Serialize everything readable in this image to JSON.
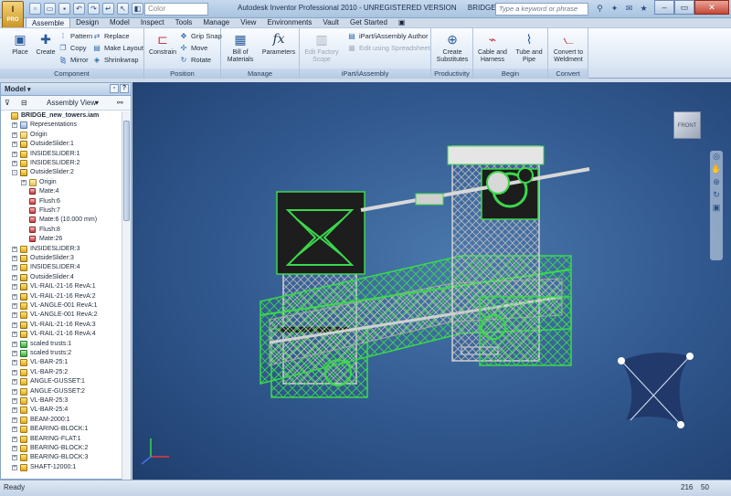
{
  "app": {
    "logo_text": "I",
    "logo_sub": "PRO",
    "title": "Autodesk Inventor Professional 2010 - UNREGISTERED VERSION",
    "document": "BRIDGE_new_towers.iam",
    "color_placeholder": "Color",
    "search_placeholder": "Type a keyword or phrase"
  },
  "tabs": [
    "Assemble",
    "Design",
    "Model",
    "Inspect",
    "Tools",
    "Manage",
    "View",
    "Environments",
    "Vault",
    "Get Started"
  ],
  "ribbon": {
    "component": {
      "title": "Component",
      "place": "Place",
      "create": "Create",
      "pattern": "Pattern",
      "copy": "Copy",
      "mirror": "Mirror",
      "replace": "Replace",
      "make_layout": "Make Layout",
      "shrinkwrap": "Shrinkwrap"
    },
    "position": {
      "title": "Position",
      "constrain": "Constrain",
      "grip_snap": "Grip Snap",
      "move": "Move",
      "rotate": "Rotate"
    },
    "manage": {
      "title": "Manage",
      "bom_line1": "Bill of",
      "bom_line2": "Materials",
      "parameters": "Parameters"
    },
    "ipart": {
      "title": "iPart/iAssembly",
      "edit_line1": "Edit Factory",
      "edit_line2": "Scope",
      "author": "iPart/iAssembly Author",
      "spreadsheet": "Edit using Spreadsheet"
    },
    "productivity": {
      "title": "Productivity",
      "create_line1": "Create",
      "create_line2": "Substitutes"
    },
    "begin": {
      "title": "Begin",
      "cable_line1": "Cable and",
      "cable_line2": "Harness",
      "tube_line1": "Tube and",
      "tube_line2": "Pipe"
    },
    "convert": {
      "title": "Convert",
      "conv_line1": "Convert to",
      "conv_line2": "Weldment"
    }
  },
  "panel": {
    "title": "Model",
    "view": "Assembly View"
  },
  "tree": [
    {
      "label": "BRIDGE_new_towers.iam",
      "icon": "root",
      "level": 0,
      "exp": ""
    },
    {
      "label": "Representations",
      "icon": "rep",
      "level": 1,
      "exp": "+"
    },
    {
      "label": "Origin",
      "icon": "folder",
      "level": 1,
      "exp": "+"
    },
    {
      "label": "OutsideSlider:1",
      "icon": "sub",
      "level": 1,
      "exp": "+"
    },
    {
      "label": "INSIDESLIDER:1",
      "icon": "part",
      "level": 1,
      "exp": "+"
    },
    {
      "label": "INSIDESLIDER:2",
      "icon": "part",
      "level": 1,
      "exp": "+"
    },
    {
      "label": "OutsideSlider:2",
      "icon": "sub",
      "level": 1,
      "exp": "-"
    },
    {
      "label": "Origin",
      "icon": "folder",
      "level": 2,
      "exp": "+"
    },
    {
      "label": "Mate:4",
      "icon": "mate",
      "level": 2,
      "exp": ""
    },
    {
      "label": "Flush:6",
      "icon": "mate",
      "level": 2,
      "exp": ""
    },
    {
      "label": "Flush:7",
      "icon": "mate",
      "level": 2,
      "exp": ""
    },
    {
      "label": "Mate:6 (10.000 mm)",
      "icon": "mate",
      "level": 2,
      "exp": ""
    },
    {
      "label": "Flush:8",
      "icon": "mate",
      "level": 2,
      "exp": ""
    },
    {
      "label": "Mate:26",
      "icon": "mate",
      "level": 2,
      "exp": ""
    },
    {
      "label": "INSIDESLIDER:3",
      "icon": "part",
      "level": 1,
      "exp": "+"
    },
    {
      "label": "OutsideSlider:3",
      "icon": "sub",
      "level": 1,
      "exp": "+"
    },
    {
      "label": "INSIDESLIDER:4",
      "icon": "part",
      "level": 1,
      "exp": "+"
    },
    {
      "label": "OutsideSlider:4",
      "icon": "sub",
      "level": 1,
      "exp": "+"
    },
    {
      "label": "VL-RAIL-21-16 RevA:1",
      "icon": "sub",
      "level": 1,
      "exp": "+"
    },
    {
      "label": "VL-RAIL-21-16 RevA:2",
      "icon": "sub",
      "level": 1,
      "exp": "+"
    },
    {
      "label": "VL-ANGLE-001 RevA:1",
      "icon": "part",
      "level": 1,
      "exp": "+"
    },
    {
      "label": "VL-ANGLE-001 RevA:2",
      "icon": "part",
      "level": 1,
      "exp": "+"
    },
    {
      "label": "VL-RAIL-21-16 RevA:3",
      "icon": "sub",
      "level": 1,
      "exp": "+"
    },
    {
      "label": "VL-RAIL-21-16 RevA:4",
      "icon": "sub",
      "level": 1,
      "exp": "+"
    },
    {
      "label": "scaled trusts:1",
      "icon": "green",
      "level": 1,
      "exp": "+"
    },
    {
      "label": "scaled trusts:2",
      "icon": "green",
      "level": 1,
      "exp": "+"
    },
    {
      "label": "VL-BAR-25:1",
      "icon": "part",
      "level": 1,
      "exp": "+"
    },
    {
      "label": "VL-BAR-25:2",
      "icon": "part",
      "level": 1,
      "exp": "+"
    },
    {
      "label": "ANGLE-GUSSET:1",
      "icon": "part",
      "level": 1,
      "exp": "+"
    },
    {
      "label": "ANGLE-GUSSET:2",
      "icon": "part",
      "level": 1,
      "exp": "+"
    },
    {
      "label": "VL-BAR-25:3",
      "icon": "part",
      "level": 1,
      "exp": "+"
    },
    {
      "label": "VL-BAR-25:4",
      "icon": "part",
      "level": 1,
      "exp": "+"
    },
    {
      "label": "BEAM-2000:1",
      "icon": "part",
      "level": 1,
      "exp": "+"
    },
    {
      "label": "BEARING-BLOCK:1",
      "icon": "part",
      "level": 1,
      "exp": "+"
    },
    {
      "label": "BEARING-FLAT:1",
      "icon": "part",
      "level": 1,
      "exp": "+"
    },
    {
      "label": "BEARING-BLOCK:2",
      "icon": "part",
      "level": 1,
      "exp": "+"
    },
    {
      "label": "BEARING-BLOCK:3",
      "icon": "part",
      "level": 1,
      "exp": "+"
    },
    {
      "label": "SHAFT-12000:1",
      "icon": "part",
      "level": 1,
      "exp": "+"
    }
  ],
  "status": {
    "text": "Ready",
    "num1": "216",
    "num2": "50"
  },
  "viewcube_label": "FRONT",
  "colors": {
    "viewport_bg": "#30578d",
    "accent_green": "#38d84a",
    "frame_gray": "#8a8a8a"
  }
}
